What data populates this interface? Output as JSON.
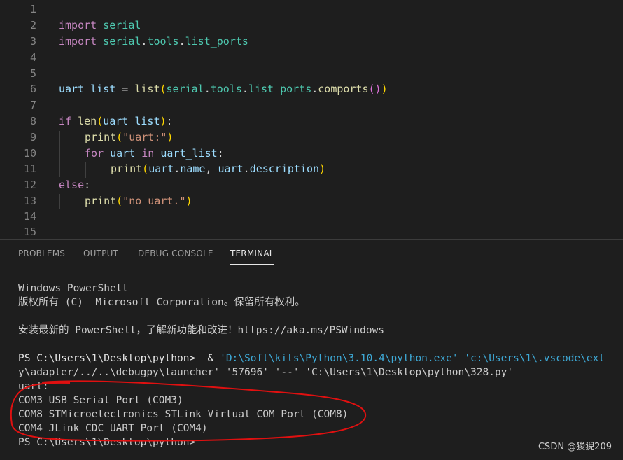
{
  "editor": {
    "line_numbers": [
      "1",
      "2",
      "3",
      "4",
      "5",
      "6",
      "7",
      "8",
      "9",
      "10",
      "11",
      "12",
      "13",
      "14",
      "15"
    ],
    "lines": {
      "l2": {
        "kw": "import",
        "mod": "serial"
      },
      "l3": {
        "kw": "import",
        "mod1": "serial",
        "d1": ".",
        "mod2": "tools",
        "d2": ".",
        "mod3": "list_ports"
      },
      "l6": {
        "var": "uart_list",
        "op": " = ",
        "fn": "list",
        "p1": "(",
        "m1": "serial",
        "d1": ".",
        "m2": "tools",
        "d2": ".",
        "m3": "list_ports",
        "d3": ".",
        "fn2": "comports",
        "p2": "()",
        "p3": ")"
      },
      "l8": {
        "kw": "if",
        "fn": "len",
        "p1": "(",
        "var": "uart_list",
        "p2": ")",
        "colon": ":"
      },
      "l9": {
        "fn": "print",
        "p1": "(",
        "str": "\"uart:\"",
        "p2": ")"
      },
      "l10": {
        "kw": "for",
        "var1": "uart",
        "kw2": "in",
        "var2": "uart_list",
        "colon": ":"
      },
      "l11": {
        "fn": "print",
        "p1": "(",
        "v1": "uart",
        "d1": ".",
        "a1": "name",
        "sep": ", ",
        "v2": "uart",
        "d2": ".",
        "a2": "description",
        "p2": ")"
      },
      "l12": {
        "kw": "else",
        "colon": ":"
      },
      "l13": {
        "fn": "print",
        "p1": "(",
        "str": "\"no uart.\"",
        "p2": ")"
      }
    }
  },
  "panel": {
    "tabs": [
      "PROBLEMS",
      "OUTPUT",
      "DEBUG CONSOLE",
      "TERMINAL"
    ],
    "active_tab": "TERMINAL",
    "terminal": {
      "l1": "Windows PowerShell",
      "l2": "版权所有 (C)  Microsoft Corporation。保留所有权利。",
      "l3": "安装最新的 PowerShell，了解新功能和改进！https://aka.ms/PSWindows",
      "l4_prompt": "PS C:\\Users\\1\\Desktop\\python>  & ",
      "l4_cmd": "'D:\\Soft\\kits\\Python\\3.10.4\\python.exe' 'c:\\Users\\1\\.vscode\\ext",
      "l5": "y\\adapter/../..\\debugpy\\launcher' '57696' '--' 'C:\\Users\\1\\Desktop\\python\\328.py'",
      "l6": "uart:",
      "l7": "COM3 USB Serial Port (COM3)",
      "l8": "COM8 STMicroelectronics STLink Virtual COM Port (COM8)",
      "l9": "COM4 JLink CDC UART Port (COM4)",
      "l10": "PS C:\\Users\\1\\Desktop\\python>"
    }
  },
  "watermark": "CSDN @狻猊209",
  "colors": {
    "background": "#1e1e1e",
    "keyword": "#c586c0",
    "module": "#4ec9b0",
    "variable": "#9cdcfe",
    "function": "#dcdcaa",
    "string": "#ce9178",
    "annotation": "#e01010"
  }
}
